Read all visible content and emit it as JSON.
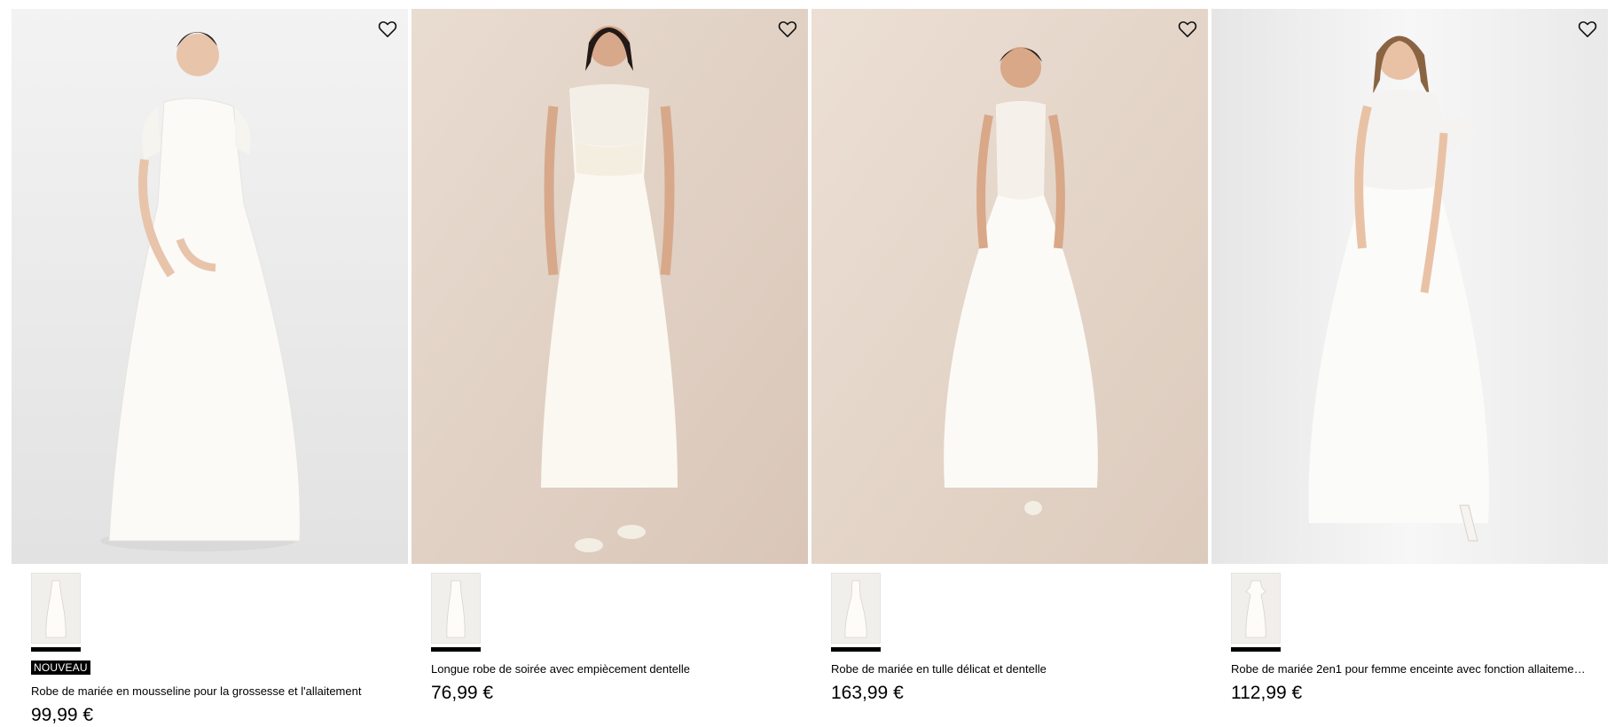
{
  "products": [
    {
      "badge": "NOUVEAU",
      "title": "Robe de mariée en mousseline pour la grossesse et l'allaitement",
      "price": "99,99 €",
      "favorite_icon": "heart-outline-icon"
    },
    {
      "badge": "",
      "title": "Longue robe de soirée avec empiècement dentelle",
      "price": "76,99 €",
      "favorite_icon": "heart-outline-icon"
    },
    {
      "badge": "",
      "title": "Robe de mariée en tulle délicat et dentelle",
      "price": "163,99 €",
      "favorite_icon": "heart-outline-icon"
    },
    {
      "badge": "",
      "title": "Robe de mariée 2en1 pour femme enceinte avec fonction allaitement ...",
      "price": "112,99 €",
      "favorite_icon": "heart-outline-icon"
    }
  ],
  "colors": {
    "photo_bg_1": "#eeeeee",
    "photo_bg_2": "#e6d8cc",
    "photo_bg_3": "#e8dcd0",
    "photo_bg_4": "#f0f0f0",
    "badge_bg": "#000000",
    "text": "#000000"
  }
}
